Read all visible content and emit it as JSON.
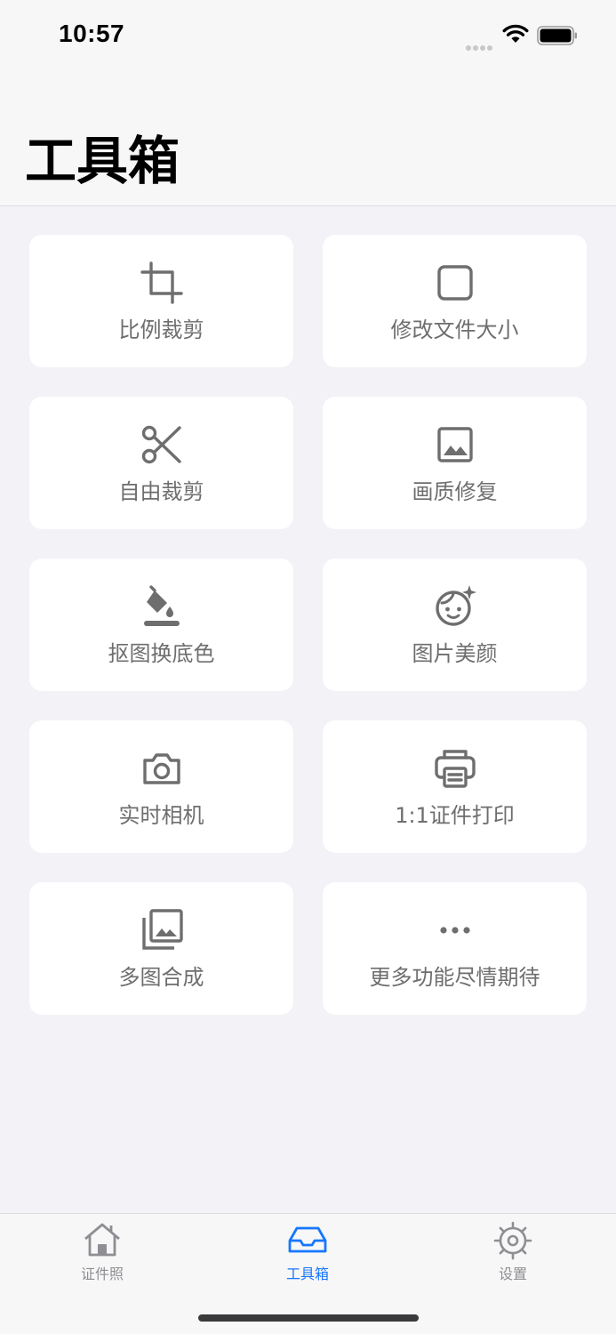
{
  "status_bar": {
    "time": "10:57",
    "icons": [
      "signal-icon",
      "wifi-icon",
      "battery-icon"
    ]
  },
  "header": {
    "title": "工具箱"
  },
  "tools": [
    {
      "label": "比例裁剪",
      "icon": "crop-icon"
    },
    {
      "label": "修改文件大小",
      "icon": "square-icon"
    },
    {
      "label": "自由裁剪",
      "icon": "scissors-icon"
    },
    {
      "label": "画质修复",
      "icon": "image-icon"
    },
    {
      "label": "抠图换底色",
      "icon": "paint-bucket-icon"
    },
    {
      "label": "图片美颜",
      "icon": "face-sparkle-icon"
    },
    {
      "label": "实时相机",
      "icon": "camera-icon"
    },
    {
      "label": "1:1证件打印",
      "icon": "printer-icon"
    },
    {
      "label": "多图合成",
      "icon": "photo-library-icon"
    },
    {
      "label": "更多功能尽情期待",
      "icon": "more-icon"
    }
  ],
  "tab_bar": {
    "tabs": [
      {
        "label": "证件照",
        "icon": "home-icon",
        "active": false
      },
      {
        "label": "工具箱",
        "icon": "inbox-icon",
        "active": true
      },
      {
        "label": "设置",
        "icon": "gear-icon",
        "active": false
      }
    ]
  },
  "colors": {
    "background": "#f2f2f7",
    "card": "#ffffff",
    "icon_gray": "#6e6e6e",
    "accent": "#1677ff",
    "tab_inactive": "#8e8e93"
  }
}
